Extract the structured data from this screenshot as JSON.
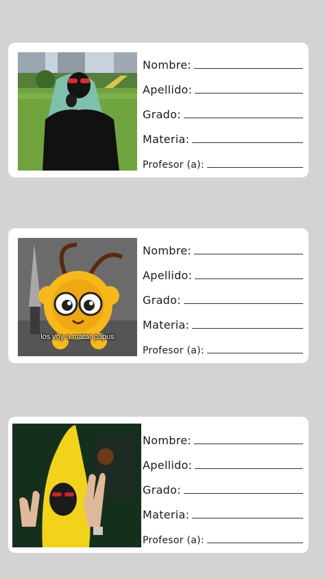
{
  "form_labels": {
    "nombre": "Nombre:",
    "apellido": "Apellido:",
    "grado": "Grado:",
    "materia": "Materia:",
    "profesor": "Profesor (a):"
  },
  "cards": [
    {
      "photo_icon": "girl-green-hair-photo"
    },
    {
      "photo_icon": "bee-with-knife-meme",
      "caption": "los voy a matar papus"
    },
    {
      "photo_icon": "banana-costume-peace-sign-photo"
    }
  ]
}
